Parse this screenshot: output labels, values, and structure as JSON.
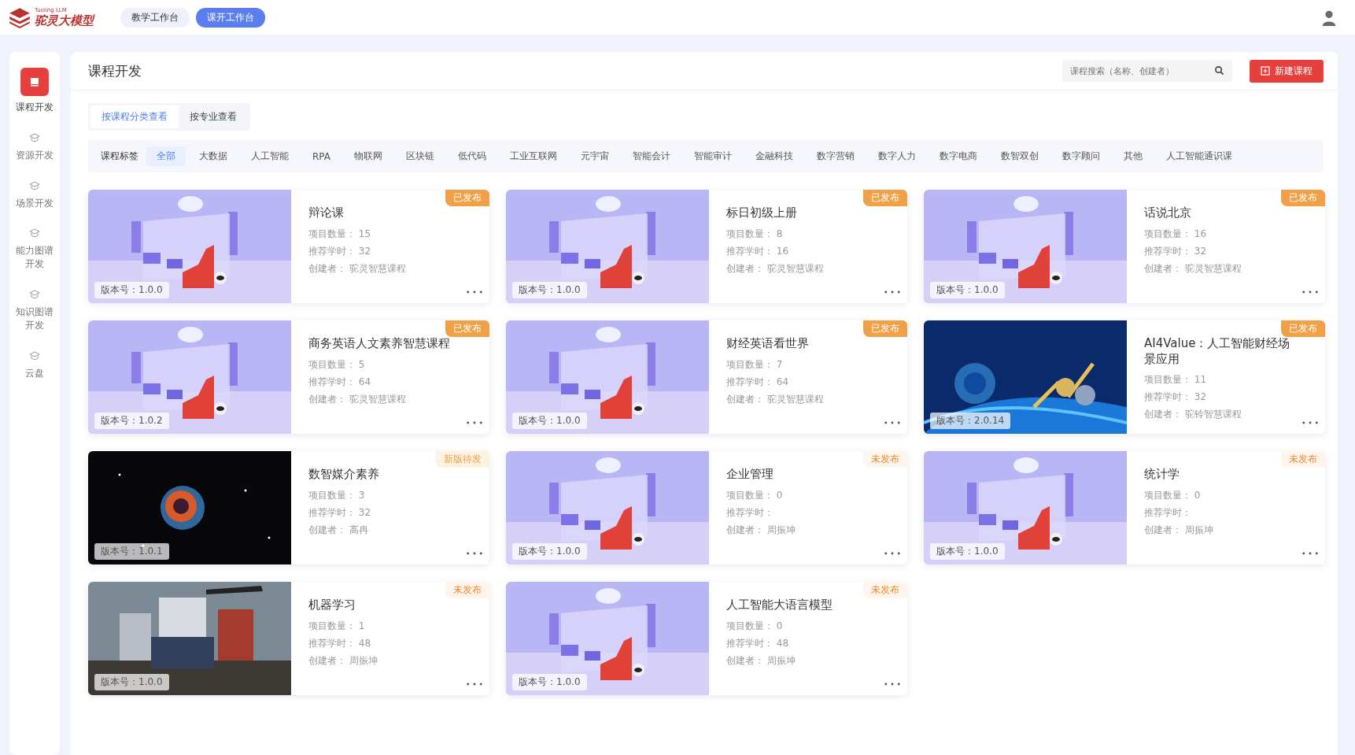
{
  "header": {
    "logo_small": "Tuoling LLM",
    "logo": "驼灵大模型",
    "workbenches": [
      {
        "label": "教学工作台",
        "selected": false
      },
      {
        "label": "课开工作台",
        "selected": true
      }
    ]
  },
  "sidebar": {
    "items": [
      {
        "label": "课程开发",
        "selected": true
      },
      {
        "label": "资源开发",
        "selected": false
      },
      {
        "label": "场景开发",
        "selected": false
      },
      {
        "label": "能力图谱开发",
        "selected": false
      },
      {
        "label": "知识图谱开发",
        "selected": false
      },
      {
        "label": "云盘",
        "selected": false
      }
    ]
  },
  "page_title": "课程开发",
  "search": {
    "placeholder": "课程搜索（名称、创建者）"
  },
  "new_button": "新建课程",
  "view_tabs": [
    {
      "label": "按课程分类查看",
      "selected": true
    },
    {
      "label": "按专业查看",
      "selected": false
    }
  ],
  "tags": {
    "label": "课程标签",
    "items": [
      {
        "label": "全部",
        "selected": true
      },
      {
        "label": "大数据",
        "selected": false
      },
      {
        "label": "人工智能",
        "selected": false
      },
      {
        "label": "RPA",
        "selected": false
      },
      {
        "label": "物联网",
        "selected": false
      },
      {
        "label": "区块链",
        "selected": false
      },
      {
        "label": "低代码",
        "selected": false
      },
      {
        "label": "工业互联网",
        "selected": false
      },
      {
        "label": "元宇宙",
        "selected": false
      },
      {
        "label": "智能会计",
        "selected": false
      },
      {
        "label": "智能审计",
        "selected": false
      },
      {
        "label": "金融科技",
        "selected": false
      },
      {
        "label": "数字营销",
        "selected": false
      },
      {
        "label": "数字人力",
        "selected": false
      },
      {
        "label": "数字电商",
        "selected": false
      },
      {
        "label": "数智双创",
        "selected": false
      },
      {
        "label": "数字顾问",
        "selected": false
      },
      {
        "label": "其他",
        "selected": false
      },
      {
        "label": "人工智能通识课",
        "selected": false
      }
    ]
  },
  "courses": [
    {
      "title": "辩论课",
      "status": "已发布",
      "kind": "published",
      "version": "版本号：1.0.0",
      "projects": "项目数量：  15",
      "hours": "推荐学时：  32",
      "creator": "创建者：  驼灵智慧课程"
    },
    {
      "title": "标日初级上册",
      "status": "已发布",
      "kind": "published",
      "version": "版本号：1.0.0",
      "projects": "项目数量：  8",
      "hours": "推荐学时：  16",
      "creator": "创建者：  驼灵智慧课程"
    },
    {
      "title": "话说北京",
      "status": "已发布",
      "kind": "published",
      "version": "版本号：1.0.0",
      "projects": "项目数量：  16",
      "hours": "推荐学时：  32",
      "creator": "创建者：  驼灵智慧课程"
    },
    {
      "title": "商务英语人文素养智慧课程",
      "status": "已发布",
      "kind": "published",
      "version": "版本号：1.0.2",
      "projects": "项目数量：  5",
      "hours": "推荐学时：  64",
      "creator": "创建者：  驼灵智慧课程"
    },
    {
      "title": "财经英语看世界",
      "status": "已发布",
      "kind": "published",
      "version": "版本号：1.0.0",
      "projects": "项目数量：  7",
      "hours": "推荐学时：  64",
      "creator": "创建者：  驼灵智慧课程"
    },
    {
      "title": "AI4Value：人工智能财经场景应用",
      "status": "已发布",
      "kind": "published",
      "version": "版本号：2.0.14",
      "projects": "项目数量：  11",
      "hours": "推荐学时：  32",
      "creator": "创建者：  驼铃智慧课程"
    },
    {
      "title": "数智媒介素养",
      "status": "新版待发",
      "kind": "pending",
      "version": "版本号：1.0.1",
      "projects": "项目数量：  3",
      "hours": "推荐学时：  32",
      "creator": "创建者：  高冉"
    },
    {
      "title": "企业管理",
      "status": "未发布",
      "kind": "unpublished",
      "version": "版本号：1.0.0",
      "projects": "项目数量：  0",
      "hours": "推荐学时：",
      "creator": "创建者：  周振坤"
    },
    {
      "title": "统计学",
      "status": "未发布",
      "kind": "unpublished",
      "version": "版本号：1.0.0",
      "projects": "项目数量：  0",
      "hours": "推荐学时：",
      "creator": "创建者：  周振坤"
    },
    {
      "title": "机器学习",
      "status": "未发布",
      "kind": "unpublished",
      "version": "版本号：1.0.0",
      "projects": "项目数量：  1",
      "hours": "推荐学时：  48",
      "creator": "创建者：  周振坤"
    },
    {
      "title": "人工智能大语言模型",
      "status": "未发布",
      "kind": "unpublished",
      "version": "版本号：1.0.0",
      "projects": "项目数量：  0",
      "hours": "推荐学时：  48",
      "creator": "创建者：  周振坤"
    }
  ]
}
